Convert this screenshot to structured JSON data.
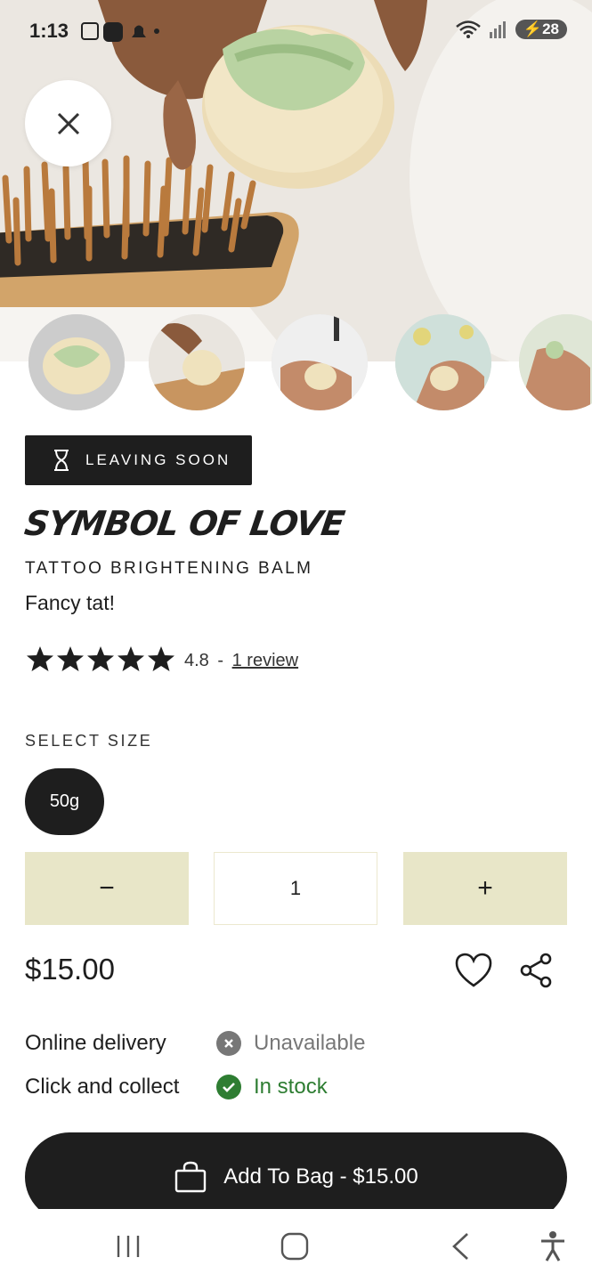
{
  "status_bar": {
    "time": "1:13",
    "battery": "28"
  },
  "colors": {
    "accent_tan": "#e8e6c8",
    "dark": "#1e1e1e",
    "in_stock_green": "#2e7d32",
    "unavailable_gray": "#777777"
  },
  "icons": [
    "close-icon",
    "hourglass-icon",
    "star-icon",
    "minus-icon",
    "plus-icon",
    "heart-icon",
    "share-icon",
    "x-circle-icon",
    "check-circle-icon",
    "shopping-bag-icon",
    "recents-icon",
    "home-icon",
    "back-icon",
    "accessibility-icon"
  ],
  "product": {
    "badge": "LEAVING SOON",
    "name": "SYMBOL OF LOVE",
    "subtitle": "TATTOO BRIGHTENING BALM",
    "tagline": "Fancy tat!",
    "rating": 4.8,
    "rating_text": "4.8",
    "separator": "-",
    "review_link": "1 review",
    "price": "$15.00"
  },
  "size": {
    "label": "SELECT SIZE",
    "options": [
      "50g"
    ],
    "selected": "50g"
  },
  "quantity": {
    "minus": "−",
    "value": "1",
    "plus": "+"
  },
  "availability": [
    {
      "label": "Online delivery",
      "status": "Unavailable",
      "available": false
    },
    {
      "label": "Click and collect",
      "status": "In stock",
      "available": true
    }
  ],
  "cta": {
    "label": "Add To Bag - $15.00"
  }
}
